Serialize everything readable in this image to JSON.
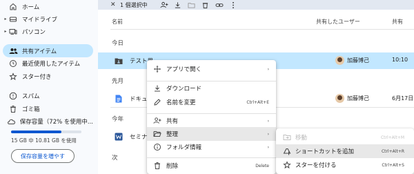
{
  "sidebar": {
    "items": [
      {
        "label": "ホーム",
        "icon": "home-icon",
        "arrow": ""
      },
      {
        "label": "マイドライブ",
        "icon": "drive-icon",
        "arrow": "▸"
      },
      {
        "label": "パソコン",
        "icon": "computer-icon",
        "arrow": "▸"
      },
      {
        "label": "共有アイテム",
        "icon": "people-icon",
        "arrow": "",
        "active": true
      },
      {
        "label": "最近使用したアイテム",
        "icon": "clock-icon",
        "arrow": ""
      },
      {
        "label": "スター付き",
        "icon": "star-icon",
        "arrow": ""
      },
      {
        "label": "スパム",
        "icon": "spam-icon",
        "arrow": ""
      },
      {
        "label": "ゴミ箱",
        "icon": "trash-icon",
        "arrow": ""
      },
      {
        "label": "保存容量（72% を使用中...",
        "icon": "cloud-icon",
        "arrow": ""
      }
    ],
    "storage_text": "15 GB 中 10.81 GB を使用",
    "storage_percent": 72,
    "upgrade_label": "保存容量を増やす"
  },
  "toolbar": {
    "close_glyph": "✕",
    "selection_text": "1 個選択中"
  },
  "headers": {
    "name": "名前",
    "shared_by": "共有したユーザー",
    "shared_date": "共有"
  },
  "sections": {
    "today": "今日",
    "last_month": "先月",
    "this_year": "今年",
    "next": "次"
  },
  "files": [
    {
      "name": "テスト用",
      "icon": "shared-folder-icon",
      "owner": "加藤博己",
      "date": "10:10"
    },
    {
      "name": "ドキュ",
      "icon": "docs-icon",
      "owner": "加藤博己",
      "date": "6月17日"
    },
    {
      "name": "セミナ",
      "icon": "word-icon",
      "owner": "",
      "date": ""
    }
  ],
  "context_menu": {
    "items": [
      {
        "label": "アプリで開く",
        "icon": "move-icon",
        "shortcut": "",
        "submenu": "›"
      },
      {
        "label": "ダウンロード",
        "icon": "download-icon",
        "shortcut": "",
        "submenu": ""
      },
      {
        "label": "名前を変更",
        "icon": "edit-icon",
        "shortcut": "Ctrl+Alt+E",
        "submenu": ""
      },
      {
        "label": "共有",
        "icon": "person-add-icon",
        "shortcut": "",
        "submenu": "›"
      },
      {
        "label": "整理",
        "icon": "folder-open-icon",
        "shortcut": "",
        "submenu": "›"
      },
      {
        "label": "フォルダ情報",
        "icon": "info-icon",
        "shortcut": "",
        "submenu": "›"
      },
      {
        "label": "削除",
        "icon": "trash-icon",
        "shortcut": "Delete",
        "submenu": ""
      }
    ]
  },
  "organize_submenu": {
    "items": [
      {
        "label": "移動",
        "shortcut": "Ctrl+Alt+M",
        "disabled": true
      },
      {
        "label": "ショートカットを追加",
        "shortcut": "Ctrl+Alt+R",
        "disabled": false
      },
      {
        "label": "スターを付ける",
        "shortcut": "Ctrl+Alt+S",
        "disabled": false
      }
    ]
  },
  "colors": {
    "accent": "#0b57d0",
    "selected_row": "#c2e7ff",
    "sidebar_bg": "#f8fafd",
    "toolbar_bg": "#e2e8f1"
  }
}
